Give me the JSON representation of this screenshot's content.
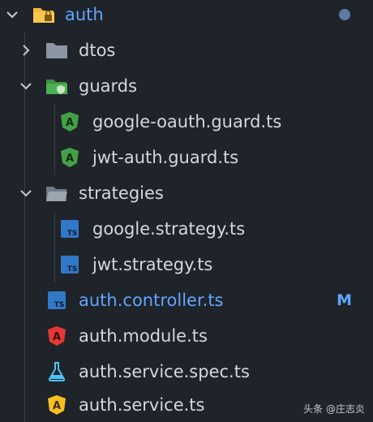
{
  "tree": {
    "root": {
      "label": "auth",
      "state": "expanded",
      "modified_dot": true
    },
    "dtos": {
      "label": "dtos",
      "state": "collapsed"
    },
    "guards": {
      "label": "guards",
      "state": "expanded",
      "children": [
        {
          "label": "google-oauth.guard.ts",
          "icon": "angular-green-icon"
        },
        {
          "label": "jwt-auth.guard.ts",
          "icon": "angular-green-icon"
        }
      ]
    },
    "strategies": {
      "label": "strategies",
      "state": "expanded",
      "children": [
        {
          "label": "google.strategy.ts",
          "icon": "typescript-icon"
        },
        {
          "label": "jwt.strategy.ts",
          "icon": "typescript-icon"
        }
      ]
    },
    "files": [
      {
        "label": "auth.controller.ts",
        "icon": "typescript-icon",
        "status": "M"
      },
      {
        "label": "auth.module.ts",
        "icon": "angular-red-icon"
      },
      {
        "label": "auth.service.spec.ts",
        "icon": "flask-icon"
      },
      {
        "label": "auth.service.ts",
        "icon": "angular-yellow-icon"
      }
    ],
    "ts_icon_text": "TS",
    "angular_icon_text": "A"
  },
  "watermark": "头条 @庄志炎",
  "colors": {
    "background": "#1f232a",
    "accent_blue": "#5ea7ff",
    "folder_grey": "#8a96a3",
    "folder_green": "#4caf50",
    "angular_green": "#43a047",
    "angular_red": "#e53935",
    "angular_yellow": "#f6c021",
    "ts_blue": "#3178c6"
  }
}
